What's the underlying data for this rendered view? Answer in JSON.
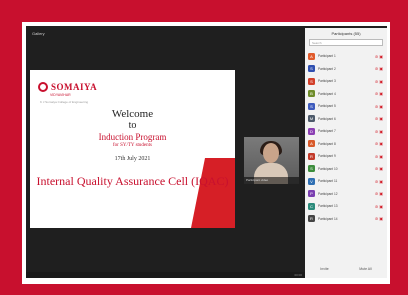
{
  "meeting": {
    "top_label": "Gallery"
  },
  "slide": {
    "brand": "SOMAIYA",
    "brand_sub": "VIDYAVIHAR",
    "tagline": "K J Somaiya College of Engineering",
    "welcome": "Welcome",
    "to": "to",
    "program": "Induction Program",
    "for_line": "for SY/TY students",
    "date": "17th July 2021",
    "cell": "Internal Quality Assurance Cell (IQAC)"
  },
  "speaker": {
    "name": "Participant video"
  },
  "panel": {
    "title": "Participants (55)",
    "search_placeholder": "Search",
    "participants": [
      {
        "initial": "A",
        "name": "Participant 1",
        "color": "#e05a2b"
      },
      {
        "initial": "S",
        "name": "Participant 2",
        "color": "#2f4fb0"
      },
      {
        "initial": "S",
        "name": "Participant 3",
        "color": "#d23f2a"
      },
      {
        "initial": "B",
        "name": "Participant 4",
        "color": "#6e8c2a"
      },
      {
        "initial": "S",
        "name": "Participant 5",
        "color": "#3e5bbd"
      },
      {
        "initial": "M",
        "name": "Participant 6",
        "color": "#4d5a6a"
      },
      {
        "initial": "D",
        "name": "Participant 7",
        "color": "#8b3fb3"
      },
      {
        "initial": "A",
        "name": "Participant 8",
        "color": "#d85a2a"
      },
      {
        "initial": "R",
        "name": "Participant 9",
        "color": "#c23a2a"
      },
      {
        "initial": "S",
        "name": "Participant 10",
        "color": "#3c8d3c"
      },
      {
        "initial": "V",
        "name": "Participant 11",
        "color": "#2f6fb3"
      },
      {
        "initial": "P",
        "name": "Participant 12",
        "color": "#7a3fb0"
      },
      {
        "initial": "C",
        "name": "Participant 13",
        "color": "#2a8a7a"
      },
      {
        "initial": "R",
        "name": "Participant 14",
        "color": "#444444"
      }
    ],
    "invite_label": "Invite",
    "mute_all_label": "Mute All"
  },
  "status": {
    "timer": "00:00"
  },
  "colors": {
    "frame_red": "#c8102e",
    "brand_red": "#c8102e",
    "meeting_bg": "#1f1f1f"
  }
}
